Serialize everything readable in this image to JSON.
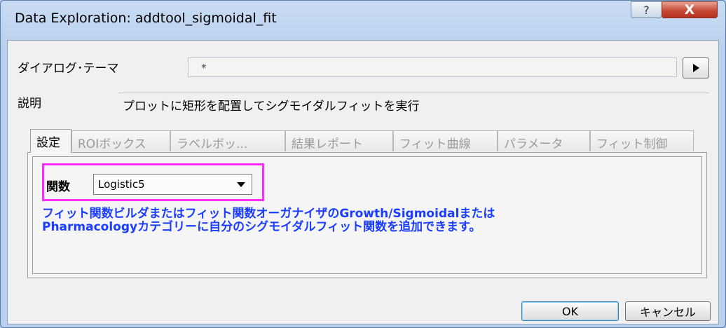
{
  "window": {
    "title": "Data Exploration: addtool_sigmoidal_fit",
    "help_label": "?",
    "close_label": "X"
  },
  "theme": {
    "label": "ダイアログ･テーマ",
    "value": "*"
  },
  "description": {
    "label": "説明",
    "value": "プロットに矩形を配置してシグモイダルフィットを実行"
  },
  "tabs": [
    {
      "label": "設定",
      "active": true
    },
    {
      "label": "ROIボックス",
      "active": false
    },
    {
      "label": "ラベルボッ...",
      "active": false
    },
    {
      "label": "結果レポート",
      "active": false
    },
    {
      "label": "フィット曲線",
      "active": false
    },
    {
      "label": "パラメータ",
      "active": false
    },
    {
      "label": "フィット制御",
      "active": false
    }
  ],
  "settings": {
    "function_label": "関数",
    "function_value": "Logistic5",
    "info_line1": "フィット関数ビルダまたはフィット関数オーガナイザのGrowth/Sigmoidalまたは",
    "info_line2": "Pharmacologyカテゴリーに自分のシグモイダルフィット関数を追加できます。"
  },
  "buttons": {
    "ok": "OK",
    "cancel": "キャンセル"
  },
  "colors": {
    "highlight": "#ff2bff",
    "info_text": "#1a3cff",
    "close_button": "#c64a36"
  }
}
